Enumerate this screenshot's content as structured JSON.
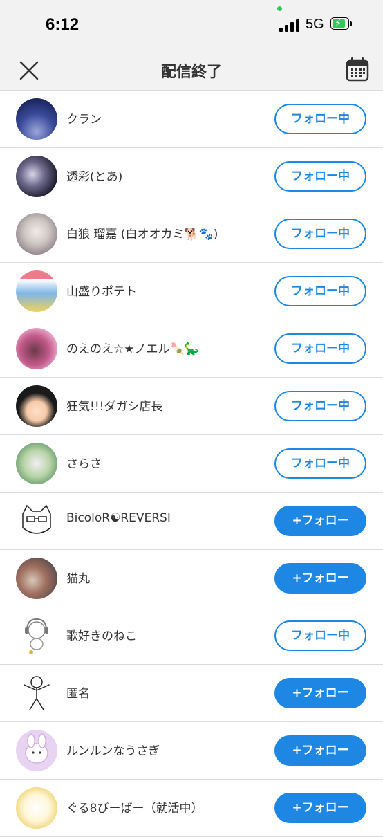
{
  "status": {
    "time": "6:12",
    "network": "5G"
  },
  "header": {
    "title": "配信終了",
    "close_icon": "close-icon",
    "calendar_icon": "calendar-icon"
  },
  "colors": {
    "accent": "#1e86e3",
    "header_bg": "#f2f2f2",
    "battery": "#34c759"
  },
  "users": [
    {
      "name": "クラン",
      "button": "フォロー中",
      "following": true
    },
    {
      "name": "透彩(とあ)",
      "button": "フォロー中",
      "following": true
    },
    {
      "name": "白狼 瑠嘉 (白オオカミ🐕🐾)",
      "button": "フォロー中",
      "following": true
    },
    {
      "name": "山盛りポテト",
      "button": "フォロー中",
      "following": true
    },
    {
      "name": "のえのえ☆★ノエル🍡🦕",
      "button": "フォロー中",
      "following": true
    },
    {
      "name": "狂気!!!ダガシ店長",
      "button": "フォロー中",
      "following": true
    },
    {
      "name": "さらさ",
      "button": "フォロー中",
      "following": true
    },
    {
      "name": "BicoloR☯REVERSI",
      "button": "+フォロー",
      "following": false
    },
    {
      "name": "猫丸",
      "button": "+フォロー",
      "following": false
    },
    {
      "name": "歌好きのねこ",
      "button": "フォロー中",
      "following": true
    },
    {
      "name": "匿名",
      "button": "+フォロー",
      "following": false
    },
    {
      "name": "ルンルンなうさぎ",
      "button": "+フォロー",
      "following": false
    },
    {
      "name": "ぐる8びーばー（就活中）",
      "button": "+フォロー",
      "following": false
    }
  ]
}
